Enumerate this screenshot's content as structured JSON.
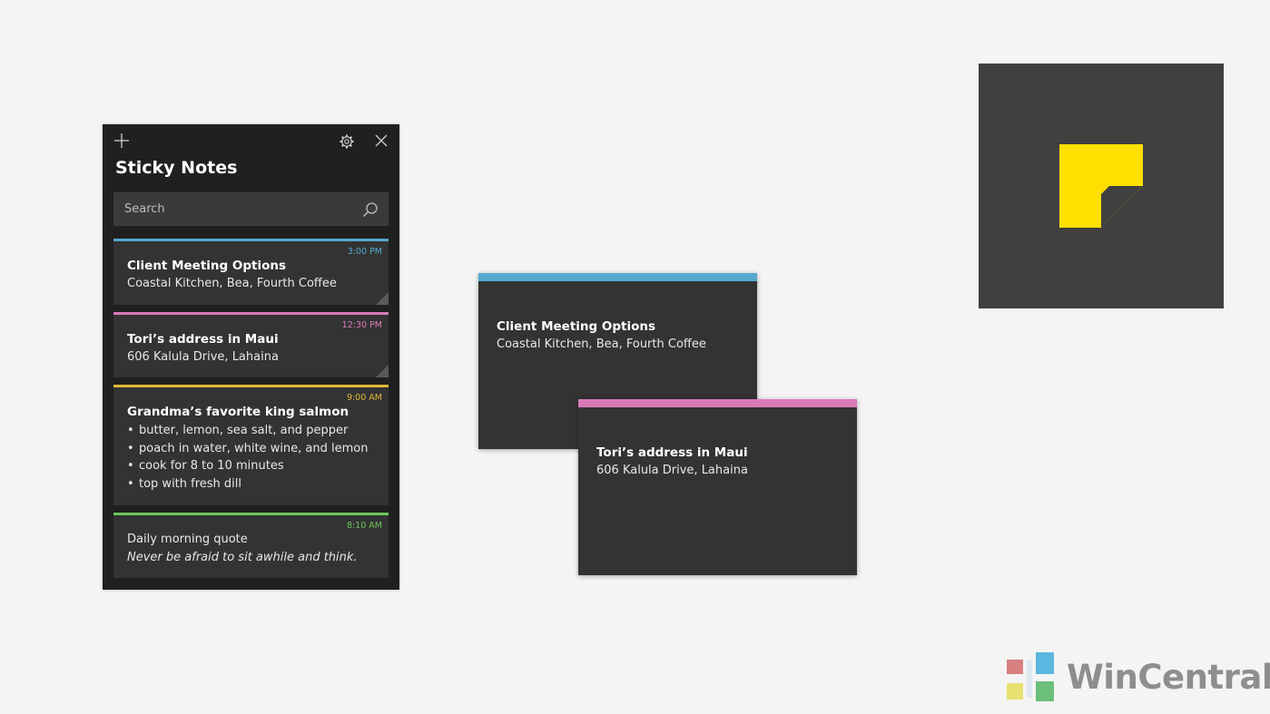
{
  "app": {
    "title": "Sticky Notes",
    "search": {
      "placeholder": "Search"
    },
    "toolbar": {
      "add_icon": "plus-icon",
      "settings_icon": "gear-icon",
      "close_icon": "close-icon"
    }
  },
  "notes": [
    {
      "time": "3:00 PM",
      "title": "Client Meeting Options",
      "body": "Coastal Kitchen, Bea, Fourth Coffee",
      "color": "#55a9ce"
    },
    {
      "time": "12:30 PM",
      "title": "Tori’s address in Maui",
      "body": "606 Kalula Drive, Lahaina",
      "color": "#d97ab8"
    },
    {
      "time": "9:00 AM",
      "title": "Grandma’s favorite king salmon",
      "items": [
        "butter, lemon, sea salt, and pepper",
        "poach in water, white wine, and lemon",
        "cook for 8 to 10 minutes",
        "top with fresh dill"
      ],
      "color": "#e0b737"
    },
    {
      "time": "8:10 AM",
      "title": "Daily morning quote",
      "body": "Never be afraid to sit awhile and think.",
      "color": "#6cc55a"
    }
  ],
  "bullet_char": "•",
  "floating_notes": [
    {
      "title": "Client Meeting Options",
      "body": "Coastal Kitchen, Bea, Fourth Coffee",
      "color": "#55a9ce"
    },
    {
      "title": "Tori’s address in Maui",
      "body": "606 Kalula Drive, Lahaina",
      "color": "#d97ab8"
    }
  ],
  "app_tile": {
    "background": "#404040",
    "icon": "sticky-note-icon",
    "icon_color": "#ffe000"
  },
  "watermark": {
    "text": "WinCentral"
  }
}
